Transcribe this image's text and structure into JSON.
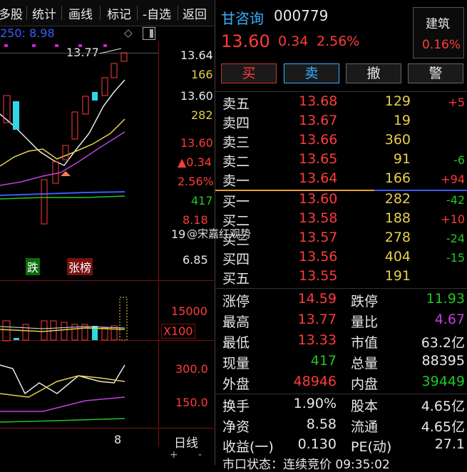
{
  "menu": {
    "items": [
      "多股",
      "统计",
      "画线",
      "标记",
      "-自选",
      "返回"
    ]
  },
  "chart": {
    "ma_legend": "250: 8.98",
    "high_marker": "13.77",
    "right_axis": [
      "13.64",
      "166",
      "13.60",
      "282",
      "13.60",
      "▲0.34",
      "2.56%",
      "417",
      "8.18",
      "19",
      "6.85",
      "15000",
      "X100",
      "300.0",
      "150.0"
    ],
    "tag_die": "跌",
    "tag_zhangbang": "张榜",
    "x_label": "8",
    "period": "日线",
    "bottom_buttons": [
      "+",
      "-"
    ]
  },
  "watermark": "@宋嘉红观势",
  "quote": {
    "name": "甘咨询",
    "code": "000779",
    "price": "13.60",
    "change": "0.34",
    "change_pct": "2.56%",
    "sector": "建筑",
    "sector_pct": "0.16%",
    "buttons": [
      "买",
      "卖",
      "撤",
      "警"
    ],
    "asks": [
      {
        "label": "卖五",
        "price": "13.68",
        "vol": "129",
        "delta": "+5"
      },
      {
        "label": "卖四",
        "price": "13.67",
        "vol": "19",
        "delta": ""
      },
      {
        "label": "卖三",
        "price": "13.66",
        "vol": "360",
        "delta": ""
      },
      {
        "label": "卖二",
        "price": "13.65",
        "vol": "91",
        "delta": "-6"
      },
      {
        "label": "卖一",
        "price": "13.64",
        "vol": "166",
        "delta": "+94"
      }
    ],
    "bids": [
      {
        "label": "买一",
        "price": "13.60",
        "vol": "282",
        "delta": "-42"
      },
      {
        "label": "买二",
        "price": "13.58",
        "vol": "188",
        "delta": "+10"
      },
      {
        "label": "买三",
        "price": "13.57",
        "vol": "278",
        "delta": "-24"
      },
      {
        "label": "买四",
        "price": "13.56",
        "vol": "404",
        "delta": "-15"
      },
      {
        "label": "买五",
        "price": "13.55",
        "vol": "191",
        "delta": ""
      }
    ],
    "stats": [
      {
        "l1": "涨停",
        "v1": "14.59",
        "l2": "跌停",
        "v2": "11.93"
      },
      {
        "l1": "最高",
        "v1": "13.77",
        "l2": "量比",
        "v2": "4.67"
      },
      {
        "l1": "最低",
        "v1": "13.33",
        "l2": "市值",
        "v2": "63.2亿"
      },
      {
        "l1": "现量",
        "v1": "417",
        "l2": "总量",
        "v2": "88395"
      },
      {
        "l1": "外盘",
        "v1": "48946",
        "l2": "内盘",
        "v2": "39449"
      }
    ],
    "stats2": [
      {
        "l1": "换手",
        "v1": "1.90%",
        "l2": "股本",
        "v2": "4.65亿"
      },
      {
        "l1": "净资",
        "v1": "8.58",
        "l2": "流通",
        "v2": "4.65亿"
      },
      {
        "l1": "收益(一)",
        "v1": "0.130",
        "l2": "PE(动)",
        "v2": "27.1"
      }
    ],
    "footer": "市口状态：连续竞价 09:35:02"
  }
}
